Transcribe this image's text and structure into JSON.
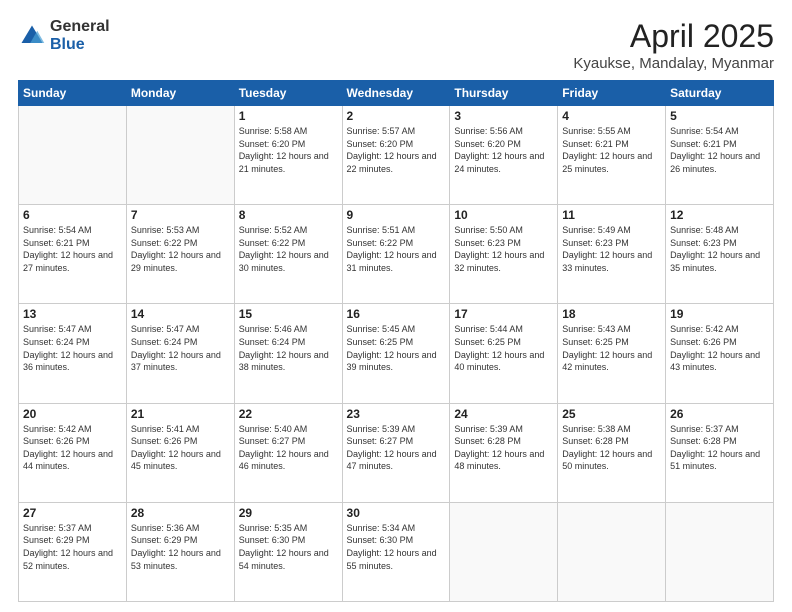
{
  "logo": {
    "general": "General",
    "blue": "Blue"
  },
  "header": {
    "month": "April 2025",
    "location": "Kyaukse, Mandalay, Myanmar"
  },
  "weekdays": [
    "Sunday",
    "Monday",
    "Tuesday",
    "Wednesday",
    "Thursday",
    "Friday",
    "Saturday"
  ],
  "weeks": [
    [
      {
        "day": "",
        "info": ""
      },
      {
        "day": "",
        "info": ""
      },
      {
        "day": "1",
        "info": "Sunrise: 5:58 AM\nSunset: 6:20 PM\nDaylight: 12 hours and 21 minutes."
      },
      {
        "day": "2",
        "info": "Sunrise: 5:57 AM\nSunset: 6:20 PM\nDaylight: 12 hours and 22 minutes."
      },
      {
        "day": "3",
        "info": "Sunrise: 5:56 AM\nSunset: 6:20 PM\nDaylight: 12 hours and 24 minutes."
      },
      {
        "day": "4",
        "info": "Sunrise: 5:55 AM\nSunset: 6:21 PM\nDaylight: 12 hours and 25 minutes."
      },
      {
        "day": "5",
        "info": "Sunrise: 5:54 AM\nSunset: 6:21 PM\nDaylight: 12 hours and 26 minutes."
      }
    ],
    [
      {
        "day": "6",
        "info": "Sunrise: 5:54 AM\nSunset: 6:21 PM\nDaylight: 12 hours and 27 minutes."
      },
      {
        "day": "7",
        "info": "Sunrise: 5:53 AM\nSunset: 6:22 PM\nDaylight: 12 hours and 29 minutes."
      },
      {
        "day": "8",
        "info": "Sunrise: 5:52 AM\nSunset: 6:22 PM\nDaylight: 12 hours and 30 minutes."
      },
      {
        "day": "9",
        "info": "Sunrise: 5:51 AM\nSunset: 6:22 PM\nDaylight: 12 hours and 31 minutes."
      },
      {
        "day": "10",
        "info": "Sunrise: 5:50 AM\nSunset: 6:23 PM\nDaylight: 12 hours and 32 minutes."
      },
      {
        "day": "11",
        "info": "Sunrise: 5:49 AM\nSunset: 6:23 PM\nDaylight: 12 hours and 33 minutes."
      },
      {
        "day": "12",
        "info": "Sunrise: 5:48 AM\nSunset: 6:23 PM\nDaylight: 12 hours and 35 minutes."
      }
    ],
    [
      {
        "day": "13",
        "info": "Sunrise: 5:47 AM\nSunset: 6:24 PM\nDaylight: 12 hours and 36 minutes."
      },
      {
        "day": "14",
        "info": "Sunrise: 5:47 AM\nSunset: 6:24 PM\nDaylight: 12 hours and 37 minutes."
      },
      {
        "day": "15",
        "info": "Sunrise: 5:46 AM\nSunset: 6:24 PM\nDaylight: 12 hours and 38 minutes."
      },
      {
        "day": "16",
        "info": "Sunrise: 5:45 AM\nSunset: 6:25 PM\nDaylight: 12 hours and 39 minutes."
      },
      {
        "day": "17",
        "info": "Sunrise: 5:44 AM\nSunset: 6:25 PM\nDaylight: 12 hours and 40 minutes."
      },
      {
        "day": "18",
        "info": "Sunrise: 5:43 AM\nSunset: 6:25 PM\nDaylight: 12 hours and 42 minutes."
      },
      {
        "day": "19",
        "info": "Sunrise: 5:42 AM\nSunset: 6:26 PM\nDaylight: 12 hours and 43 minutes."
      }
    ],
    [
      {
        "day": "20",
        "info": "Sunrise: 5:42 AM\nSunset: 6:26 PM\nDaylight: 12 hours and 44 minutes."
      },
      {
        "day": "21",
        "info": "Sunrise: 5:41 AM\nSunset: 6:26 PM\nDaylight: 12 hours and 45 minutes."
      },
      {
        "day": "22",
        "info": "Sunrise: 5:40 AM\nSunset: 6:27 PM\nDaylight: 12 hours and 46 minutes."
      },
      {
        "day": "23",
        "info": "Sunrise: 5:39 AM\nSunset: 6:27 PM\nDaylight: 12 hours and 47 minutes."
      },
      {
        "day": "24",
        "info": "Sunrise: 5:39 AM\nSunset: 6:28 PM\nDaylight: 12 hours and 48 minutes."
      },
      {
        "day": "25",
        "info": "Sunrise: 5:38 AM\nSunset: 6:28 PM\nDaylight: 12 hours and 50 minutes."
      },
      {
        "day": "26",
        "info": "Sunrise: 5:37 AM\nSunset: 6:28 PM\nDaylight: 12 hours and 51 minutes."
      }
    ],
    [
      {
        "day": "27",
        "info": "Sunrise: 5:37 AM\nSunset: 6:29 PM\nDaylight: 12 hours and 52 minutes."
      },
      {
        "day": "28",
        "info": "Sunrise: 5:36 AM\nSunset: 6:29 PM\nDaylight: 12 hours and 53 minutes."
      },
      {
        "day": "29",
        "info": "Sunrise: 5:35 AM\nSunset: 6:30 PM\nDaylight: 12 hours and 54 minutes."
      },
      {
        "day": "30",
        "info": "Sunrise: 5:34 AM\nSunset: 6:30 PM\nDaylight: 12 hours and 55 minutes."
      },
      {
        "day": "",
        "info": ""
      },
      {
        "day": "",
        "info": ""
      },
      {
        "day": "",
        "info": ""
      }
    ]
  ]
}
